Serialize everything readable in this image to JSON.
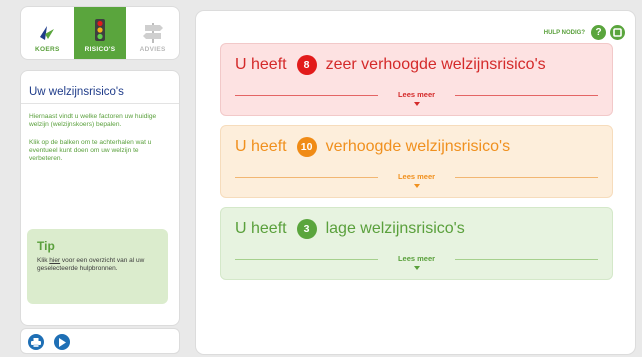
{
  "nav": {
    "tabs": [
      {
        "label": "KOERS",
        "icon": "compass-icon"
      },
      {
        "label": "RISICO'S",
        "icon": "traffic-light-icon"
      },
      {
        "label": "ADVIES",
        "icon": "signpost-icon"
      }
    ]
  },
  "sidebar": {
    "title": "Uw welzijnsrisico's",
    "paragraph1": "Hiernaast vindt u welke factoren uw huidige welzijn (welzijnskoers) bepalen.",
    "paragraph2": "Klik op de balken om te achterhalen wat u eventueel kunt doen om uw welzijn te verbeteren.",
    "tip": {
      "title": "Tip",
      "text_before": "Klik ",
      "link": "hier",
      "text_after": " voor een overzicht van al uw geselecteerde hulpbronnen."
    }
  },
  "footer": {
    "icons": [
      "print-icon",
      "play-icon"
    ]
  },
  "help": {
    "label": "HULP NODIG?",
    "icons": [
      "help-icon",
      "close-icon"
    ]
  },
  "risks": [
    {
      "prefix": "U heeft",
      "count": "8",
      "label": "zeer verhoogde welzijnsrisico's",
      "more": "Lees meer",
      "color": "#e21b1b"
    },
    {
      "prefix": "U heeft",
      "count": "10",
      "label": "verhoogde welzijnsrisico's",
      "more": "Lees meer",
      "color": "#f08b16"
    },
    {
      "prefix": "U heeft",
      "count": "3",
      "label": "lage welzijnsrisico's",
      "more": "Lees meer",
      "color": "#5aa53d"
    }
  ]
}
